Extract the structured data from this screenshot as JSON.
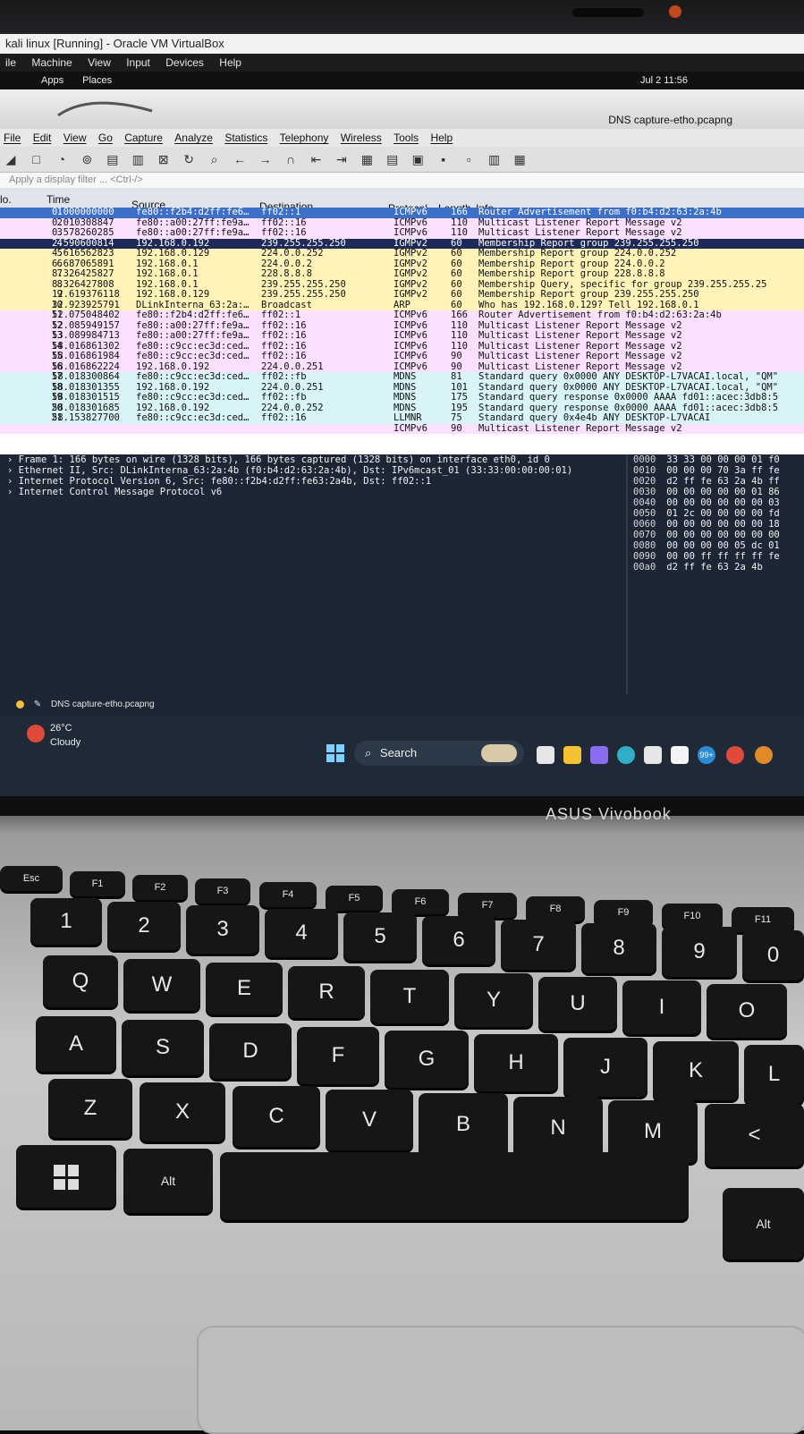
{
  "vbox": {
    "title": "kali linux  [Running] - Oracle VM VirtualBox",
    "menu": [
      "ile",
      "Machine",
      "View",
      "Input",
      "Devices",
      "Help"
    ]
  },
  "kali": {
    "apps": "Apps",
    "places": "Places",
    "clock": "Jul 2  11:56"
  },
  "wireshark": {
    "window_title": "DNS capture-etho.pcapng",
    "menu": [
      "File",
      "Edit",
      "View",
      "Go",
      "Capture",
      "Analyze",
      "Statistics",
      "Telephony",
      "Wireless",
      "Tools",
      "Help"
    ],
    "filter_placeholder": "Apply a display filter ... <Ctrl-/>",
    "columns": {
      "no": "lo.",
      "time": "Time",
      "source": "Source",
      "destination": "Destination",
      "protocol": "Protocol",
      "length": "Length",
      "info": "Info"
    },
    "packets": [
      {
        "no": "1",
        "time": "0.000000000",
        "src": "fe80::f2b4:d2ff:fe6…",
        "dst": "ff02::1",
        "proto": "ICMPv6",
        "len": "166",
        "info": "Router Advertisement from f0:b4:d2:63:2a:4b",
        "bg": "#3b6fc9",
        "fg": "#ffffff"
      },
      {
        "no": "2",
        "time": "0.010308847",
        "src": "fe80::a00:27ff:fe9a…",
        "dst": "ff02::16",
        "proto": "ICMPv6",
        "len": "110",
        "info": "Multicast Listener Report Message v2",
        "bg": "#fce0ff",
        "fg": "#111111"
      },
      {
        "no": "3",
        "time": "0.578260285",
        "src": "fe80::a00:27ff:fe9a…",
        "dst": "ff02::16",
        "proto": "ICMPv6",
        "len": "110",
        "info": "Multicast Listener Report Message v2",
        "bg": "#fce0ff",
        "fg": "#111111"
      },
      {
        "no": "4",
        "time": "2.590600814",
        "src": "192.168.0.192",
        "dst": "239.255.255.250",
        "proto": "IGMPv2",
        "len": "60",
        "info": "Membership Report group 239.255.255.250",
        "bg": "#1e2a5a",
        "fg": "#ffffff"
      },
      {
        "no": "5",
        "time": "4.616562823",
        "src": "192.168.0.129",
        "dst": "224.0.0.252",
        "proto": "IGMPv2",
        "len": "60",
        "info": "Membership Report group 224.0.0.252",
        "bg": "#fff3b8",
        "fg": "#111111"
      },
      {
        "no": "6",
        "time": "6.687065891",
        "src": "192.168.0.1",
        "dst": "224.0.0.2",
        "proto": "IGMPv2",
        "len": "60",
        "info": "Membership Report group 224.0.0.2",
        "bg": "#fff3b8",
        "fg": "#111111"
      },
      {
        "no": "7",
        "time": "8.326425827",
        "src": "192.168.0.1",
        "dst": "228.8.8.8",
        "proto": "IGMPv2",
        "len": "60",
        "info": "Membership Report group 228.8.8.8",
        "bg": "#fff3b8",
        "fg": "#111111"
      },
      {
        "no": "8",
        "time": "8.326427808",
        "src": "192.168.0.1",
        "dst": "239.255.255.250",
        "proto": "IGMPv2",
        "len": "60",
        "info": "Membership Query, specific for group 239.255.255.25",
        "bg": "#fff3b8",
        "fg": "#111111"
      },
      {
        "no": "9",
        "time": "12.619376118",
        "src": "192.168.0.129",
        "dst": "239.255.255.250",
        "proto": "IGMPv2",
        "len": "60",
        "info": "Membership Report group 239.255.255.250",
        "bg": "#fff3b8",
        "fg": "#111111"
      },
      {
        "no": "10",
        "time": "32.923925791",
        "src": "DLinkInterna_63:2a:…",
        "dst": "Broadcast",
        "proto": "ARP",
        "len": "60",
        "info": "Who has 192.168.0.129? Tell 192.168.0.1",
        "bg": "#fff3b8",
        "fg": "#111111"
      },
      {
        "no": "11",
        "time": "52.075048402",
        "src": "fe80::f2b4:d2ff:fe6…",
        "dst": "ff02::1",
        "proto": "ICMPv6",
        "len": "166",
        "info": "Router Advertisement from f0:b4:d2:63:2a:4b",
        "bg": "#fce0ff",
        "fg": "#111111"
      },
      {
        "no": "12",
        "time": "52.085949157",
        "src": "fe80::a00:27ff:fe9a…",
        "dst": "ff02::16",
        "proto": "ICMPv6",
        "len": "110",
        "info": "Multicast Listener Report Message v2",
        "bg": "#fce0ff",
        "fg": "#111111"
      },
      {
        "no": "13",
        "time": "53.089984713",
        "src": "fe80::a00:27ff:fe9a…",
        "dst": "ff02::16",
        "proto": "ICMPv6",
        "len": "110",
        "info": "Multicast Listener Report Message v2",
        "bg": "#fce0ff",
        "fg": "#111111"
      },
      {
        "no": "14",
        "time": "58.016861302",
        "src": "fe80::c9cc:ec3d:ced…",
        "dst": "ff02::16",
        "proto": "ICMPv6",
        "len": "110",
        "info": "Multicast Listener Report Message v2",
        "bg": "#fce0ff",
        "fg": "#111111"
      },
      {
        "no": "15",
        "time": "58.016861984",
        "src": "fe80::c9cc:ec3d:ced…",
        "dst": "ff02::16",
        "proto": "ICMPv6",
        "len": "90",
        "info": "Multicast Listener Report Message v2",
        "bg": "#fce0ff",
        "fg": "#111111"
      },
      {
        "no": "16",
        "time": "58.016862224",
        "src": "192.168.0.192",
        "dst": "224.0.0.251",
        "proto": "ICMPv6",
        "len": "90",
        "info": "Multicast Listener Report Message v2",
        "bg": "#fce0ff",
        "fg": "#111111"
      },
      {
        "no": "17",
        "time": "58.018300864",
        "src": "fe80::c9cc:ec3d:ced…",
        "dst": "ff02::fb",
        "proto": "MDNS",
        "len": "81",
        "info": "Standard query 0x0000 ANY DESKTOP-L7VACAI.local, \"QM\"",
        "bg": "#d8f4f8",
        "fg": "#111111"
      },
      {
        "no": "18",
        "time": "58.018301355",
        "src": "192.168.0.192",
        "dst": "224.0.0.251",
        "proto": "MDNS",
        "len": "101",
        "info": "Standard query 0x0000 ANY DESKTOP-L7VACAI.local, \"QM\"",
        "bg": "#d8f4f8",
        "fg": "#111111"
      },
      {
        "no": "19",
        "time": "58.018301515",
        "src": "fe80::c9cc:ec3d:ced…",
        "dst": "ff02::fb",
        "proto": "MDNS",
        "len": "175",
        "info": "Standard query response 0x0000 AAAA fd01::acec:3db8:5",
        "bg": "#d8f4f8",
        "fg": "#111111"
      },
      {
        "no": "20",
        "time": "58.018301685",
        "src": "192.168.0.192",
        "dst": "224.0.0.252",
        "proto": "MDNS",
        "len": "195",
        "info": "Standard query response 0x0000 AAAA fd01::acec:3db8:5",
        "bg": "#d8f4f8",
        "fg": "#111111"
      },
      {
        "no": "21",
        "time": "58.153827700",
        "src": "fe80::c9cc:ec3d:ced…",
        "dst": "ff02::16",
        "proto": "LLMNR",
        "len": "75",
        "info": "Standard query 0x4e4b ANY DESKTOP-L7VACAI",
        "bg": "#d8f4f8",
        "fg": "#111111"
      },
      {
        "no": "",
        "time": "",
        "src": "",
        "dst": "",
        "proto": "ICMPv6",
        "len": "90",
        "info": "Multicast Listener Report Message v2",
        "bg": "#fce0ff",
        "fg": "#111111"
      }
    ],
    "details": [
      "Frame 1: 166 bytes on wire (1328 bits), 166 bytes captured (1328 bits) on interface eth0, id 0",
      "Ethernet II, Src: DLinkInterna_63:2a:4b (f0:b4:d2:63:2a:4b), Dst: IPv6mcast_01 (33:33:00:00:00:01)",
      "Internet Protocol Version 6, Src: fe80::f2b4:d2ff:fe63:2a4b, Dst: ff02::1",
      "Internet Control Message Protocol v6"
    ],
    "hex": [
      {
        "off": "0000",
        "bytes": "33 33 00 00 00 01 f0"
      },
      {
        "off": "0010",
        "bytes": "00 00 00 70 3a ff fe"
      },
      {
        "off": "0020",
        "bytes": "d2 ff fe 63 2a 4b ff"
      },
      {
        "off": "0030",
        "bytes": "00 00 00 00 00 01 86"
      },
      {
        "off": "0040",
        "bytes": "00 00 00 00 00 00 03"
      },
      {
        "off": "0050",
        "bytes": "01 2c 00 00 00 00 fd"
      },
      {
        "off": "0060",
        "bytes": "00 00 00 00 00 00 18"
      },
      {
        "off": "0070",
        "bytes": "00 00 00 00 00 00 00"
      },
      {
        "off": "0080",
        "bytes": "00 00 00 00 05 dc 01"
      },
      {
        "off": "0090",
        "bytes": "00 00 ff ff ff ff fe"
      },
      {
        "off": "00a0",
        "bytes": "d2 ff fe 63 2a 4b"
      }
    ],
    "status_file": "DNS capture-etho.pcapng"
  },
  "taskbar": {
    "temp": "26°C",
    "condition": "Cloudy",
    "search": "Search",
    "badge": "99+"
  },
  "laptop": {
    "brand": "ASUS Vivobook",
    "keys": {
      "esc": "Esc",
      "f1": "F1",
      "f2": "F2",
      "f3": "F3",
      "f4": "F4",
      "f5": "F5",
      "f6": "F6",
      "f7": "F7",
      "f8": "F8",
      "f9": "F9",
      "f10": "F10",
      "f11": "F11",
      "n1": "1",
      "n2": "2",
      "n3": "3",
      "n4": "4",
      "n5": "5",
      "n6": "6",
      "n7": "7",
      "n8": "8",
      "n9": "9",
      "n0": "0",
      "s2": "@",
      "s3": "#",
      "s4": "$",
      "s5": "%",
      "s6": "^",
      "s7": "&",
      "s8": "*",
      "s9": "(",
      "s0": ")",
      "q": "Q",
      "w": "W",
      "e": "E",
      "r": "R",
      "t": "T",
      "y": "Y",
      "u": "U",
      "i": "I",
      "o": "O",
      "a": "A",
      "s": "S",
      "d": "D",
      "f": "F",
      "g": "G",
      "h": "H",
      "j": "J",
      "k": "K",
      "l": "L",
      "z": "Z",
      "x": "X",
      "c": "C",
      "v": "V",
      "b": "B",
      "n": "N",
      "m": "M",
      "lt": "<",
      "comma": ",",
      "alt": "Alt"
    }
  }
}
